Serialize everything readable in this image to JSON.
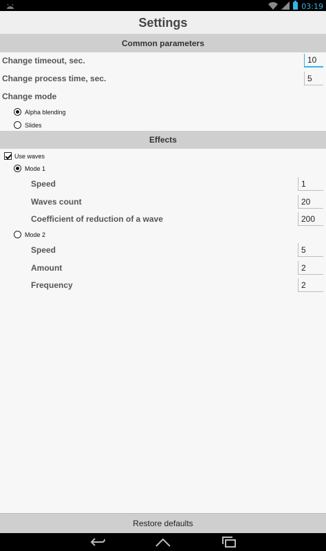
{
  "status_bar": {
    "time": "03:19",
    "icons": [
      "android-debug-icon",
      "wifi-icon",
      "signal-icon",
      "battery-icon"
    ]
  },
  "title": "Settings",
  "common": {
    "header": "Common parameters",
    "timeout": {
      "label": "Change timeout, sec.",
      "value": "10"
    },
    "process_time": {
      "label": "Change process time, sec.",
      "value": "5"
    },
    "mode": {
      "label": "Change mode",
      "options": [
        {
          "label": "Alpha blending",
          "checked": true
        },
        {
          "label": "Slides",
          "checked": false
        }
      ]
    }
  },
  "effects": {
    "header": "Effects",
    "use_waves": {
      "label": "Use waves",
      "checked": true
    },
    "mode1": {
      "label": "Mode 1",
      "checked": true,
      "speed": {
        "label": "Speed",
        "value": "1"
      },
      "waves_count": {
        "label": "Waves count",
        "value": "20"
      },
      "coefficient": {
        "label": "Coefficient of reduction of a wave",
        "value": "200"
      }
    },
    "mode2": {
      "label": "Mode 2",
      "checked": false,
      "speed": {
        "label": "Speed",
        "value": "5"
      },
      "amount": {
        "label": "Amount",
        "value": "2"
      },
      "frequency": {
        "label": "Frequency",
        "value": "2"
      }
    }
  },
  "restore_button": "Restore defaults",
  "nav": {
    "buttons": [
      "back-icon",
      "home-icon",
      "recent-apps-icon"
    ]
  },
  "colors": {
    "accent": "#33b5e5",
    "section_bg": "#cfcfcf",
    "background": "#f7f7f7"
  }
}
